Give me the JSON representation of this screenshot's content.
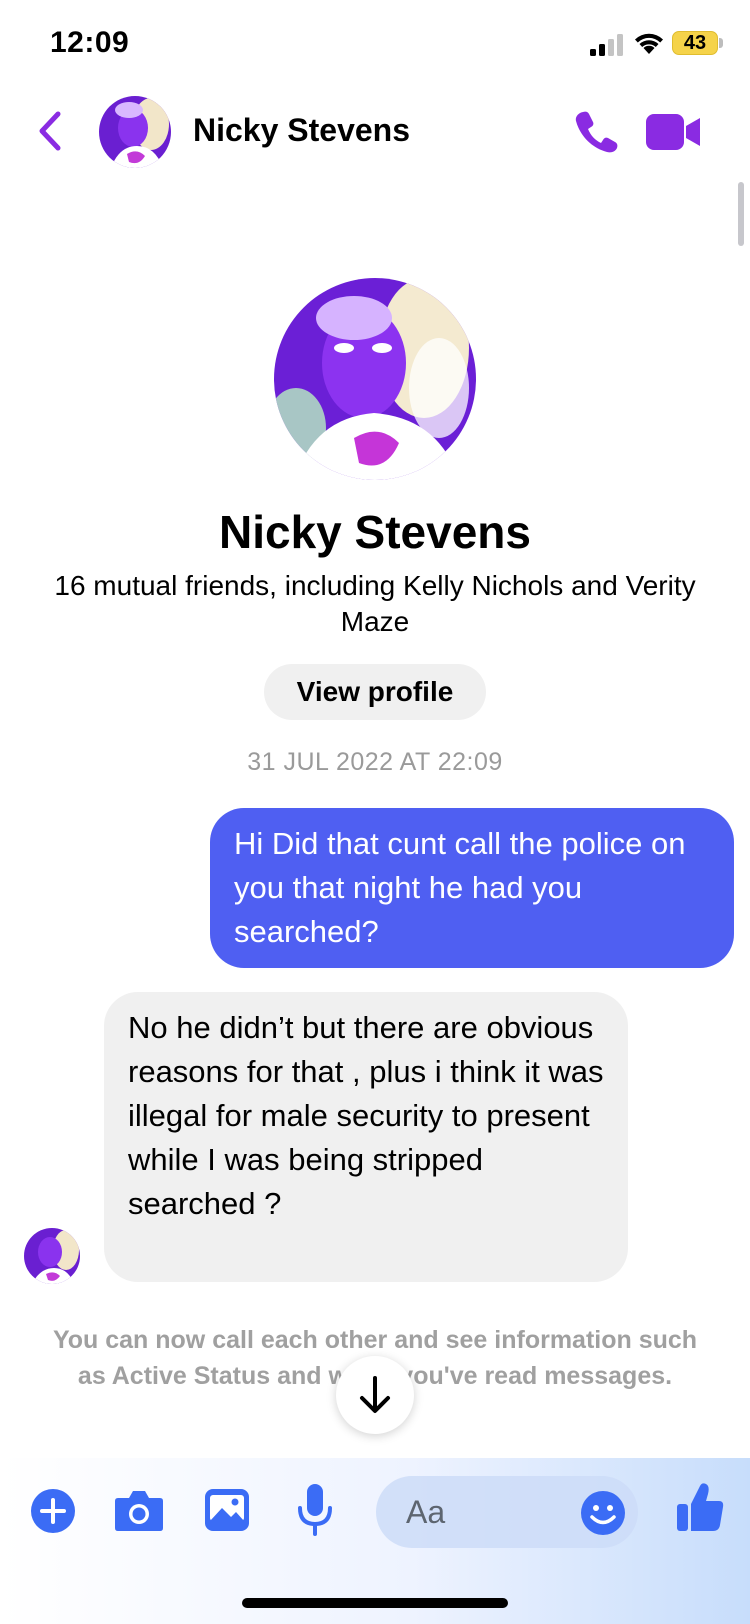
{
  "status_bar": {
    "time": "12:09",
    "battery": "43",
    "icons": [
      "signal-icon",
      "wifi-icon",
      "battery-icon"
    ]
  },
  "header": {
    "back_icon": "chevron-left-icon",
    "name": "Nicky Stevens",
    "call_icon": "phone-icon",
    "video_icon": "video-camera-icon",
    "accent_color": "#8a2be2"
  },
  "profile": {
    "name": "Nicky Stevens",
    "mutual_friends": "16 mutual friends, including Kelly Nichols and Verity Maze",
    "view_profile_label": "View profile"
  },
  "conversation": {
    "timestamp": "31 JUL 2022 AT 22:09",
    "messages": [
      {
        "direction": "outgoing",
        "text": "Hi Did that cunt call the police on you that night he had you searched?",
        "color": "#4f5ff2"
      },
      {
        "direction": "incoming",
        "text": "No he didn’t but there are obvious reasons for that , plus i think it was illegal for male security to present while I was being stripped searched ?",
        "color": "#f0f0f0"
      }
    ],
    "notice": "You can now call each other and see information such as Active Status and when you've read messages."
  },
  "composer": {
    "placeholder": "Aa",
    "icons": [
      "plus-icon",
      "camera-icon",
      "image-icon",
      "microphone-icon",
      "emoji-icon",
      "thumbs-up-icon"
    ],
    "icon_color": "#3b6cf5"
  },
  "scroll_down_icon": "arrow-down-icon"
}
